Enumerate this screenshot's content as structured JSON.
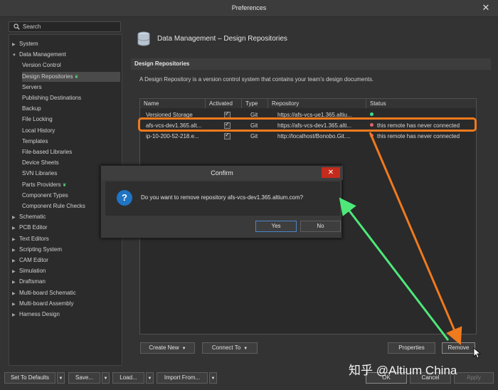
{
  "window": {
    "title": "Preferences"
  },
  "search": {
    "placeholder": "Search"
  },
  "tree": [
    {
      "label": "System",
      "level": 0,
      "expanded": false
    },
    {
      "label": "Data Management",
      "level": 0,
      "expanded": true
    },
    {
      "label": "Version Control",
      "level": 1
    },
    {
      "label": "Design Repositories",
      "level": 1,
      "selected": true,
      "badge": "❦"
    },
    {
      "label": "Servers",
      "level": 1
    },
    {
      "label": "Publishing Destinations",
      "level": 1
    },
    {
      "label": "Backup",
      "level": 1
    },
    {
      "label": "File Locking",
      "level": 1
    },
    {
      "label": "Local History",
      "level": 1
    },
    {
      "label": "Templates",
      "level": 1
    },
    {
      "label": "File-based Libraries",
      "level": 1
    },
    {
      "label": "Device Sheets",
      "level": 1
    },
    {
      "label": "SVN Libraries",
      "level": 1
    },
    {
      "label": "Parts Providers",
      "level": 1,
      "badge": "❦"
    },
    {
      "label": "Component Types",
      "level": 1
    },
    {
      "label": "Component Rule Checks",
      "level": 1
    },
    {
      "label": "Schematic",
      "level": 0,
      "expanded": false
    },
    {
      "label": "PCB Editor",
      "level": 0,
      "expanded": false
    },
    {
      "label": "Text Editors",
      "level": 0,
      "expanded": false
    },
    {
      "label": "Scripting System",
      "level": 0,
      "expanded": false
    },
    {
      "label": "CAM Editor",
      "level": 0,
      "expanded": false
    },
    {
      "label": "Simulation",
      "level": 0,
      "expanded": false
    },
    {
      "label": "Draftsman",
      "level": 0,
      "expanded": false
    },
    {
      "label": "Multi-board Schematic",
      "level": 0,
      "expanded": false
    },
    {
      "label": "Multi-board Assembly",
      "level": 0,
      "expanded": false
    },
    {
      "label": "Harness Design",
      "level": 0,
      "expanded": false
    }
  ],
  "page": {
    "title": "Data Management – Design Repositories",
    "section": "Design Repositories",
    "description": "A Design Repository is a version control system that contains your team's design documents."
  },
  "grid": {
    "headers": [
      "Name",
      "Activated",
      "Type",
      "Repository",
      "Status"
    ],
    "rows": [
      {
        "name": "Versioned Storage",
        "activated": true,
        "type": "Git",
        "repo": "https://afs-vcs-ue1.365.altiu...",
        "status": "",
        "status_color": "#3ddc84"
      },
      {
        "name": "afs-vcs-dev1.365.alt...",
        "activated": true,
        "type": "Git",
        "repo": "https://afs-vcs-dev1.365.alti...",
        "status": "this remote has never connected",
        "status_color": "#e06666"
      },
      {
        "name": "ip-10-200-52-218.e...",
        "activated": true,
        "type": "Git",
        "repo": "http://localhost/Bonobo.Git....",
        "status": "this remote has never connected",
        "status_color": "#e06666"
      }
    ]
  },
  "panel_buttons": {
    "create_new": "Create New",
    "connect_to": "Connect To",
    "properties": "Properties",
    "remove": "Remove"
  },
  "footer": {
    "set_defaults": "Set To Defaults",
    "save": "Save...",
    "load": "Load...",
    "import_from": "Import From...",
    "ok": "OK",
    "cancel": "Cancel",
    "apply": "Apply"
  },
  "dialog": {
    "title": "Confirm",
    "message": "Do you want to remove repository afs-vcs-dev1.365.altium.com?",
    "yes": "Yes",
    "no": "No"
  },
  "watermark": "知乎 @Altium China",
  "colors": {
    "highlight": "#f07a1e",
    "arrow_green": "#4ee87a",
    "arrow_orange": "#f07a1e",
    "dialog_close": "#c42b1c"
  }
}
